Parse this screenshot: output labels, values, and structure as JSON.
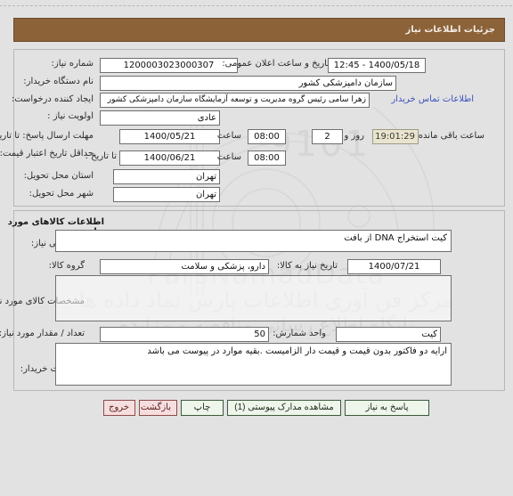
{
  "header": {
    "title": "جزئیات اطلاعات نیاز"
  },
  "request_panel": {
    "fields": {
      "need_number_label": "شماره نیاز:",
      "need_number_value": "1200003023000307",
      "public_announce_label": "تاریخ و ساعت اعلان عمومی:",
      "public_announce_value": "1400/05/18 - 12:45",
      "buyer_org_label": "نام دستگاه خریدار:",
      "buyer_org_value": "سازمان دامپزشکی کشور",
      "creator_label": "ایجاد کننده درخواست:",
      "creator_value": "زهرا سامی  رئیس گروه مدیریت و توسعه آزمایشگاه سازمان دامپزشکی کشور",
      "contact_link": "اطلاعات تماس خریدار",
      "priority_label": "اولویت نیاز :",
      "priority_value": "عادی",
      "deadline_label": "مهلت ارسال پاسخ: تا تاریخ :",
      "deadline_date": "1400/05/21",
      "deadline_hour_label": "ساعت",
      "deadline_hour": "08:00",
      "remaining_days": "2",
      "remaining_days_sep": "روز و",
      "remaining_timer": "19:01:29",
      "remaining_suffix": "ساعت باقی مانده",
      "price_validity_label": "حداقل تاریخ اعتبار قیمت:",
      "price_validity_until_label": "تا تاریخ :",
      "price_validity_date": "1400/06/21",
      "price_validity_hour_label": "ساعت",
      "price_validity_hour": "08:00",
      "province_label": "استان محل تحویل:",
      "province_value": "تهران",
      "city_label": "شهر محل تحویل:",
      "city_value": "تهران"
    }
  },
  "goods_panel": {
    "heading": "اطلاعات کالاهای مورد نیاز",
    "fields": {
      "general_desc_label": "شرح کلی نیاز:",
      "general_desc_value": "کیت استخراج  DNA از بافت",
      "group_label": "گروه کالا:",
      "group_value": "دارو، پزشکی و سلامت",
      "need_date_label": "تاریخ نیاز به کالا:",
      "need_date_value": "1400/07/21",
      "specs_label": "مشخصات کالای مورد نیاز:",
      "specs_value": "",
      "quantity_label": "تعداد / مقدار مورد نیاز:",
      "quantity_value": "50",
      "unit_label": "واحد شمارش:",
      "unit_value": "کیت",
      "buyer_notes_label": "توضیحات خریدار:",
      "buyer_notes_value": "ارایه دو فاکتور بدون قیمت و قیمت دار الزامیست .بقیه موارد در پیوست می باشد"
    }
  },
  "buttons": {
    "reply": "پاسخ به نیاز",
    "view_docs": "مشاهده مدارک پیوستی (1)",
    "print": "چاپ",
    "back": "بازگشت",
    "exit": "خروج"
  },
  "colors": {
    "title_bar": "#8c6239",
    "link": "#3b4fbe",
    "timer_bg": "#e8e4cf",
    "button_green": "#eef5ea",
    "button_red": "#f7dede",
    "page_bg": "#e2e2e2"
  }
}
